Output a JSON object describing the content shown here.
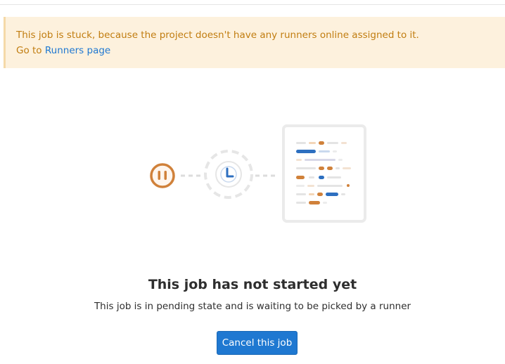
{
  "alert": {
    "message": "This job is stuck, because the project doesn't have any runners online assigned to it.",
    "prefix": "Go to",
    "link_label": "Runners page"
  },
  "empty_state": {
    "title": "This job has not started yet",
    "subtitle": "This job is in pending state and is waiting to be picked by a runner",
    "illustration": "pending-job-illustration"
  },
  "actions": {
    "cancel_label": "Cancel this job"
  },
  "colors": {
    "alert_background": "#fdf1dd",
    "alert_text": "#c17d10",
    "link": "#1f78d1",
    "primary_button": "#1f78d1",
    "pending_orange": "#d0813a",
    "clock_blue": "#2d6fc0"
  },
  "icons": [
    "pause-icon",
    "clock-icon",
    "job-log-document-icon"
  ]
}
